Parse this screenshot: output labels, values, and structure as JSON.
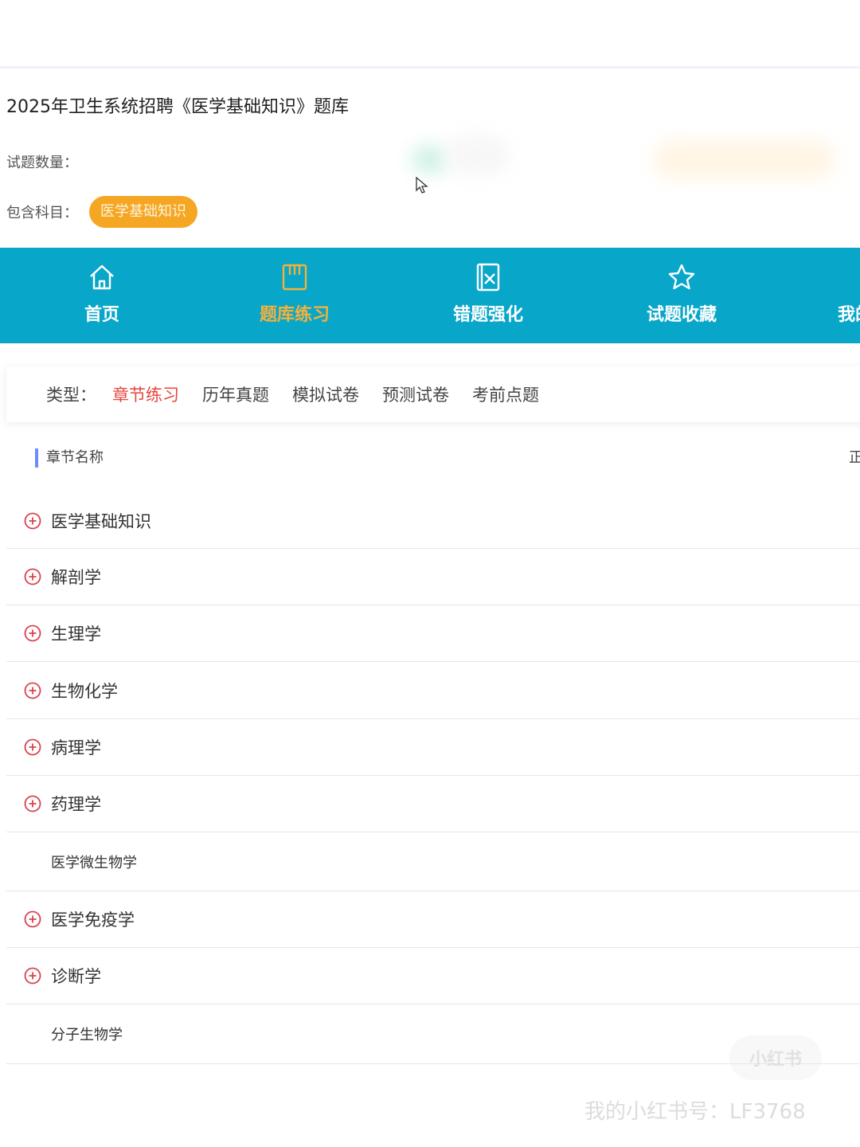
{
  "course": {
    "title": "2025年卫生系统招聘《医学基础知识》题库",
    "count_label": "试题数量：",
    "subject_label": "包含科目：",
    "subject_badge": "医学基础知识"
  },
  "nav": {
    "items": [
      {
        "label": "首页",
        "icon": "home-icon"
      },
      {
        "label": "题库练习",
        "icon": "book-icon",
        "active": true
      },
      {
        "label": "错题强化",
        "icon": "error-book-icon"
      },
      {
        "label": "试题收藏",
        "icon": "star-icon"
      },
      {
        "label": "我的",
        "icon": "user-icon"
      }
    ],
    "bg_color": "#08a6c9",
    "active_color": "#f3b13b"
  },
  "type_filter": {
    "label": "类型：",
    "tabs": [
      "章节练习",
      "历年真题",
      "模拟试卷",
      "预测试卷",
      "考前点题"
    ],
    "active_index": 0,
    "active_color": "#e8453c"
  },
  "chapters": {
    "header": "章节名称",
    "header_right": "正",
    "rows": [
      {
        "name": "医学基础知识",
        "expandable": true
      },
      {
        "name": "解剖学",
        "expandable": true
      },
      {
        "name": "生理学",
        "expandable": true
      },
      {
        "name": "生物化学",
        "expandable": true
      },
      {
        "name": "病理学",
        "expandable": true
      },
      {
        "name": "药理学",
        "expandable": true
      },
      {
        "name": "医学微生物学",
        "expandable": false
      },
      {
        "name": "医学免疫学",
        "expandable": true
      },
      {
        "name": "诊断学",
        "expandable": true
      },
      {
        "name": "分子生物学",
        "expandable": false
      }
    ]
  },
  "watermark": {
    "logo": "小红书",
    "text": "我的小红书号：LF3768"
  }
}
